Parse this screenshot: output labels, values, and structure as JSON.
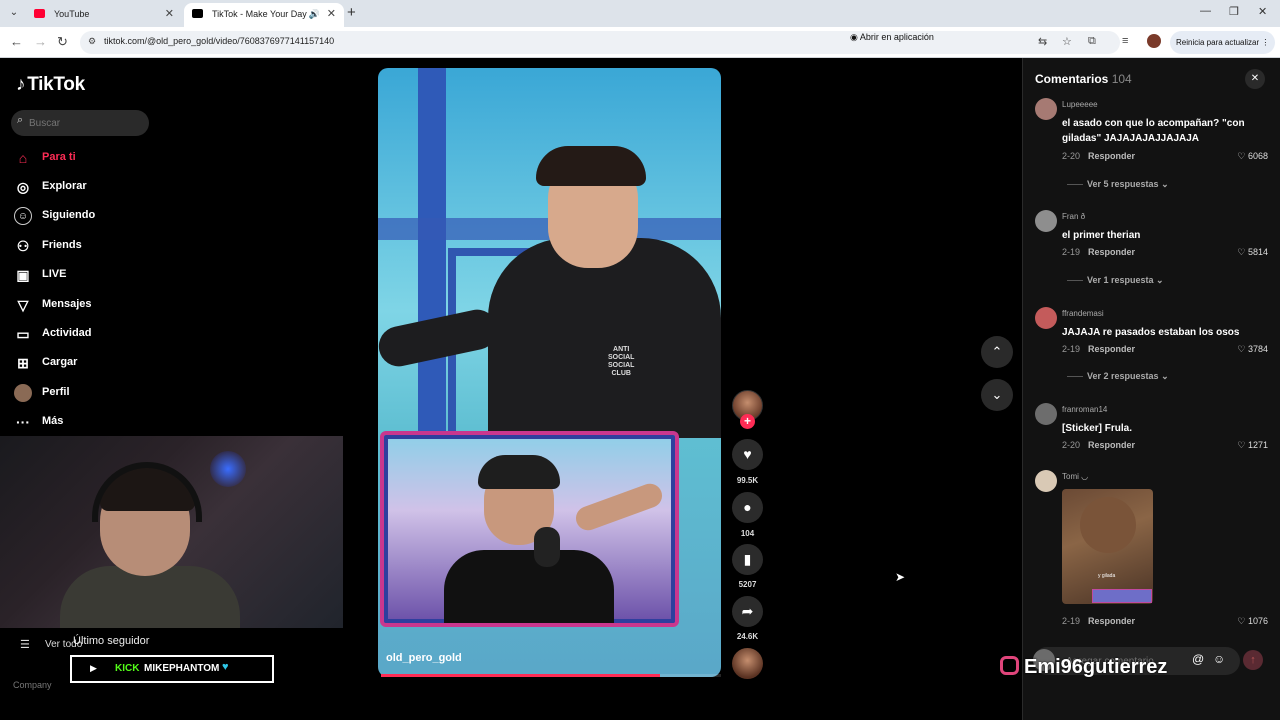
{
  "browser": {
    "tabs": [
      {
        "title": "YouTube",
        "active": false,
        "favicon_color": "#ff0033"
      },
      {
        "title": "TikTok - Make Your Day",
        "active": true,
        "favicon_color": "#000000"
      }
    ],
    "url": "tiktok.com/@old_pero_gold/video/7608376977141157140",
    "open_app_label": "Abrir en aplicación",
    "relaunch_label": "Reinicia para actualizar"
  },
  "sidebar": {
    "logo": "TikTok",
    "search_placeholder": "Buscar",
    "items": [
      {
        "label": "Para ti",
        "icon": "home-icon",
        "active": true
      },
      {
        "label": "Explorar",
        "icon": "compass-icon"
      },
      {
        "label": "Siguiendo",
        "icon": "following-icon"
      },
      {
        "label": "Friends",
        "icon": "friends-icon"
      },
      {
        "label": "LIVE",
        "icon": "live-icon"
      },
      {
        "label": "Mensajes",
        "icon": "messages-icon"
      },
      {
        "label": "Actividad",
        "icon": "activity-icon"
      },
      {
        "label": "Cargar",
        "icon": "upload-icon"
      },
      {
        "label": "Perfil",
        "icon": "profile-icon"
      },
      {
        "label": "Más",
        "icon": "more-icon"
      }
    ],
    "see_all": "Ver todo",
    "company": "Company"
  },
  "overlay": {
    "last_follower_label": "Último seguidor",
    "kick_label": "KICK",
    "follower_name": "MIKEPHANTOM",
    "instagram_handle": "Emi96gutierrez"
  },
  "video": {
    "author": "old_pero_gold",
    "progress_fraction": 0.82,
    "shirt_text": "ANTI SOCIAL SOCIAL CLUB"
  },
  "actions": {
    "likes": "99.5K",
    "comments": "104",
    "saves": "5207",
    "shares": "24.6K"
  },
  "comments_panel": {
    "title": "Comentarios",
    "count": "104",
    "add_placeholder": "Agregar comentario...",
    "reply_label": "Responder",
    "items": [
      {
        "user": "Lupeeeee",
        "text": "el asado con que lo acompañan? \"con giladas\" JAJAJAJAJJAJAJA",
        "date": "2-20",
        "likes": "6068",
        "more": "Ver 5 respuestas",
        "avatar_color": "#a67a73"
      },
      {
        "user": "Fran ð",
        "text": "el primer therian",
        "date": "2-19",
        "likes": "5814",
        "more": "Ver 1 respuesta",
        "avatar_color": "#8e8e8e"
      },
      {
        "user": "ffrandemasi",
        "text": "JAJAJA re pasados estaban los osos",
        "date": "2-19",
        "likes": "3784",
        "more": "Ver 2 respuestas",
        "avatar_color": "#c45b5b"
      },
      {
        "user": "franroman14",
        "text": "[Sticker] Frula.",
        "date": "2-20",
        "likes": "1271",
        "avatar_color": "#6d6d6d"
      },
      {
        "user": "Tomi ◡",
        "text": "",
        "date": "2-19",
        "likes": "1076",
        "avatar_color": "#d9c9b5",
        "sticker_caption": "y gilada"
      }
    ]
  }
}
